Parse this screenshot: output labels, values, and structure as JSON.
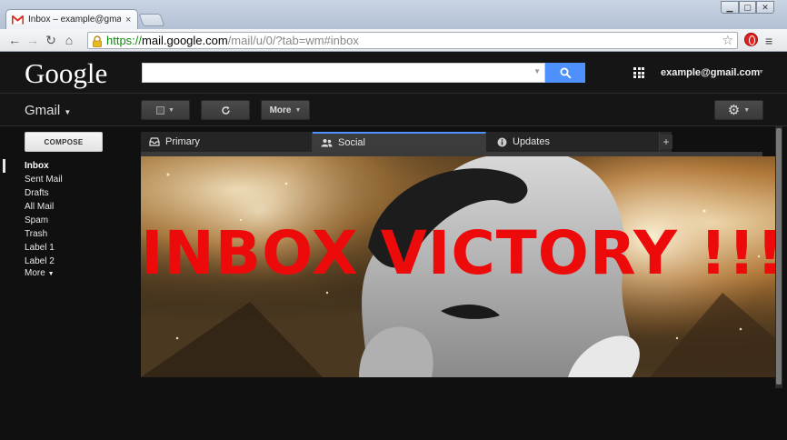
{
  "browser": {
    "tab_title": "Inbox – example@gmail.c",
    "tab_close": "×",
    "url_scheme": "https://",
    "url_host": "mail.google.com",
    "url_path": "/mail/u/0/?tab=wm#inbox"
  },
  "header": {
    "logo": "Google",
    "search_placeholder": "",
    "account": "example@gmail.com"
  },
  "toolbar": {
    "gmail_label": "Gmail",
    "more_label": "More"
  },
  "sidebar": {
    "compose_label": "COMPOSE",
    "items": [
      {
        "label": "Inbox"
      },
      {
        "label": "Sent Mail"
      },
      {
        "label": "Drafts"
      },
      {
        "label": "All Mail"
      },
      {
        "label": "Spam"
      },
      {
        "label": "Trash"
      },
      {
        "label": "Label 1"
      },
      {
        "label": "Label 2"
      },
      {
        "label": "More"
      }
    ]
  },
  "tabs": [
    {
      "label": "Primary",
      "icon": "inbox-tray-icon"
    },
    {
      "label": "Social",
      "icon": "people-icon"
    },
    {
      "label": "Updates",
      "icon": "info-icon"
    }
  ],
  "banner": {
    "text": "INBOX VICTORY !!!"
  },
  "colors": {
    "accent_blue": "#4d90fe",
    "banner_text": "#ec0a0a",
    "background": "#101010"
  }
}
